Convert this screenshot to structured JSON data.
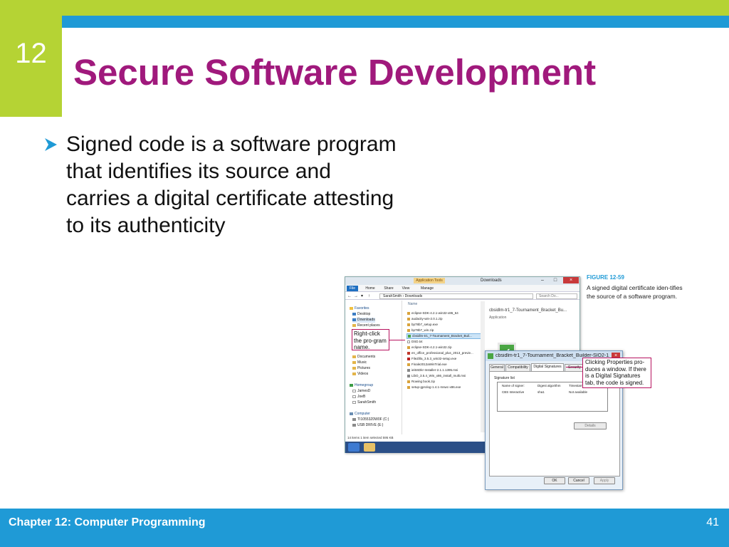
{
  "slide": {
    "chapter_number": "12",
    "title": "Secure Software Development",
    "bullet": "Signed code is a software program that identifies its source and carries a digital certificate attesting to its authenticity",
    "footer": "Chapter 12: Computer Programming",
    "page_number": "41",
    "colors": {
      "accent_green": "#b5d334",
      "accent_blue": "#1f9ad6",
      "title_magenta": "#a0197c"
    }
  },
  "figure": {
    "label": "FIGURE 12-59",
    "caption": "A signed digital certificate iden-tifies the source of a software program."
  },
  "explorer": {
    "app_tools": "Application Tools",
    "window_title": "Downloads",
    "ribbon_tabs": [
      "File",
      "Home",
      "Share",
      "View",
      "Manage"
    ],
    "path": "SarahSmith › Downloads",
    "search_placeholder": "Search Do...",
    "nav_items": [
      "Favorites",
      "Desktop",
      "Downloads",
      "Recent places",
      "Documents",
      "Music",
      "Pictures",
      "Videos",
      "Homegroup",
      "JamesD",
      "JoeB",
      "SarahSmith",
      "Computer",
      "TI10553Z0W0F (C:)",
      "USB DRIVE (E:)"
    ],
    "files_header": "Name",
    "files": [
      "eclipse-SDK-4.2.1-win32-x86_64",
      "audacity-win-2.0.1.zip",
      "bp78b7_setup.exe",
      "bp78b7_win.zip",
      "cbsidlm-tr1_7-Tournament_Bracket_Buil...",
      "DSD.txt",
      "eclipse-SDK-4.2.1-win32.zip",
      "en_office_professional_plus_2013_previe...",
      "FileZilla_3.5.3_win32-setup.exe",
      "Finale2012aWinTrial.exe",
      "iei5SDkr-Installer-2.1.1.1395.msi",
      "LibO_3.5.4_Win_x86_install_multi.msi",
      "Rowing book.zip",
      "setup-gprolog-1.4.1-mswc-x86.exe"
    ],
    "preview_name": "cbsidlm-tr1_7-Tournament_Bracket_Bu...",
    "preview_type": "Application",
    "status": "14 items     1 item selected  595 KB"
  },
  "callouts": {
    "right_click": "Right-click the pro-gram name.",
    "properties": "Clicking Properties pro-duces a window. If there is a Digital Signatures tab, the code is signed."
  },
  "dialog": {
    "title": "cbsidlm-tr1_7-Tournament_Bracket_Builder-SIO2-1...",
    "tabs": [
      "General",
      "Compatibility",
      "Digital Signatures",
      "Security"
    ],
    "signature_list_label": "Signature list",
    "columns": [
      "Name of signer:",
      "Digest algorithm",
      "Timestamp"
    ],
    "row": [
      "CBS Interactive",
      "sha1",
      "Not available"
    ],
    "details_button": "Details",
    "ok_button": "OK",
    "cancel_button": "Cancel",
    "apply_button": "Apply"
  }
}
